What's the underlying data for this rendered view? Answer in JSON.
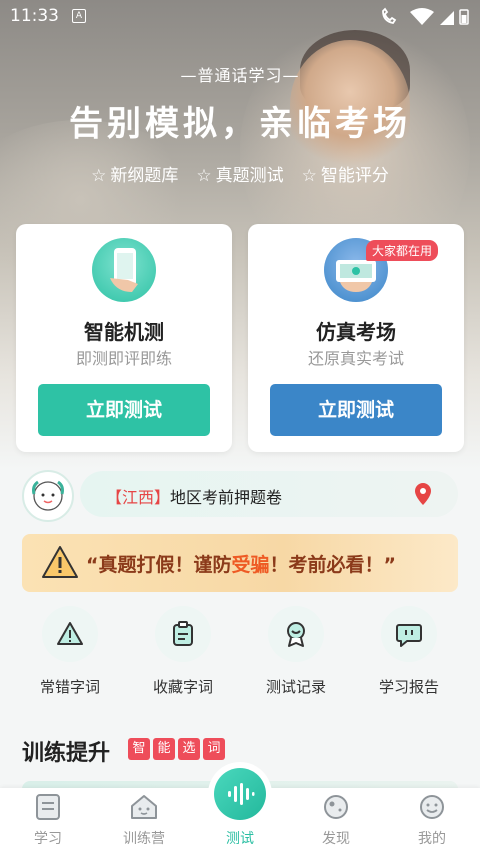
{
  "status": {
    "time": "11:33",
    "notif_glyph": "A"
  },
  "hero": {
    "subtitle": "—普通话学习—",
    "title": "告别模拟，亲临考场",
    "features": [
      "新纲题库",
      "真题测试",
      "智能评分"
    ]
  },
  "cards": [
    {
      "title": "智能机测",
      "subtitle": "即测即评即练",
      "button": "立即测试",
      "button_color": "#2ec2a5"
    },
    {
      "title": "仿真考场",
      "subtitle": "还原真实考试",
      "button": "立即测试",
      "button_color": "#3b86c8",
      "badge": "大家都在用"
    }
  ],
  "region": {
    "tag": "【江西】",
    "text": "地区考前押题卷"
  },
  "banner": {
    "q_open": "“",
    "part1": "真题打假！谨防",
    "highlight": "受骗",
    "part2": "！考前必看！",
    "q_close": "”"
  },
  "tools": [
    {
      "label": "常错字词",
      "icon": "warning-icon"
    },
    {
      "label": "收藏字词",
      "icon": "clipboard-icon"
    },
    {
      "label": "测试记录",
      "icon": "medal-icon"
    },
    {
      "label": "学习报告",
      "icon": "chat-report-icon"
    }
  ],
  "training": {
    "title": "训练提升",
    "tags": [
      "智",
      "能",
      "选",
      "词"
    ]
  },
  "nav": [
    {
      "label": "学习",
      "icon": "book-icon"
    },
    {
      "label": "训练营",
      "icon": "house-icon"
    },
    {
      "label": "测试",
      "icon": "voice-icon",
      "active": true
    },
    {
      "label": "发现",
      "icon": "planet-icon"
    },
    {
      "label": "我的",
      "icon": "smile-icon"
    }
  ],
  "colors": {
    "accent": "#2bbfa3",
    "blue": "#3b86c8",
    "red": "#ee4d5a"
  }
}
